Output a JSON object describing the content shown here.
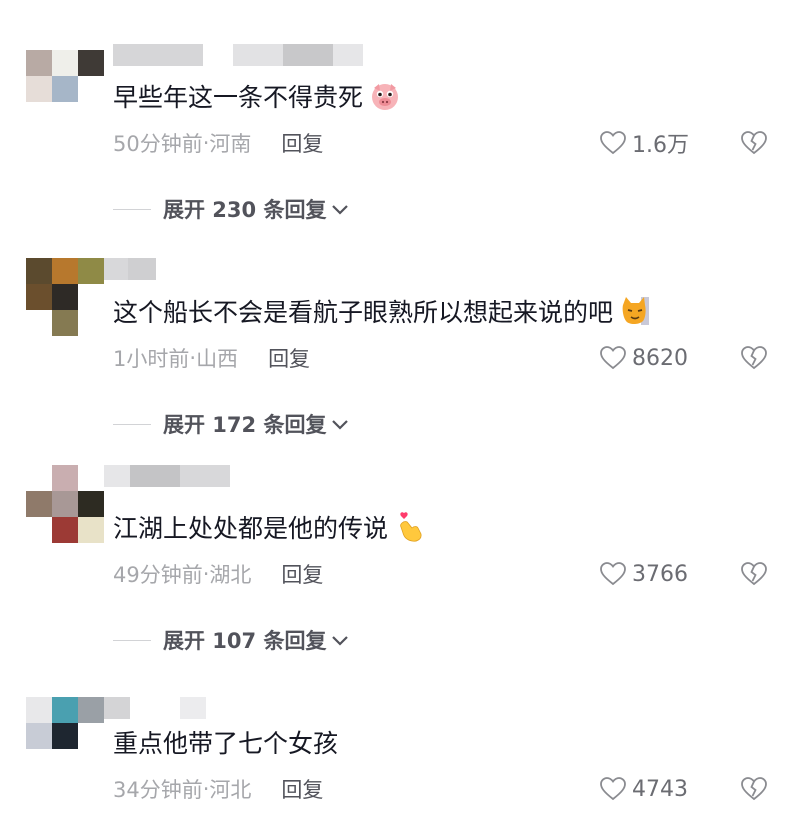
{
  "comments": [
    {
      "text": "早些年这一条不得贵死",
      "emoji_icon": "pig-face-icon",
      "time": "50分钟前",
      "location": "河南",
      "reply_label": "回复",
      "likes": "1.6万",
      "expand_label": "展开 230 条回复"
    },
    {
      "text": "这个船长不会是看航子眼熟所以想起来说的吧",
      "emoji_icon": "cat-face-icon",
      "time": "1小时前",
      "location": "山西",
      "reply_label": "回复",
      "likes": "8620",
      "expand_label": "展开 172 条回复"
    },
    {
      "text": "江湖上处处都是他的传说",
      "emoji_icon": "finger-heart-icon",
      "time": "49分钟前",
      "location": "湖北",
      "reply_label": "回复",
      "likes": "3766",
      "expand_label": "展开 107 条回复"
    },
    {
      "text": "重点他带了七个女孩",
      "emoji_icon": "",
      "time": "34分钟前",
      "location": "河北",
      "reply_label": "回复",
      "likes": "4743"
    }
  ],
  "meta_separator": "·",
  "colors": {
    "text": "#161823",
    "meta": "#a6a7ab",
    "reply": "#52535b",
    "divider": "#d2d3d6"
  }
}
